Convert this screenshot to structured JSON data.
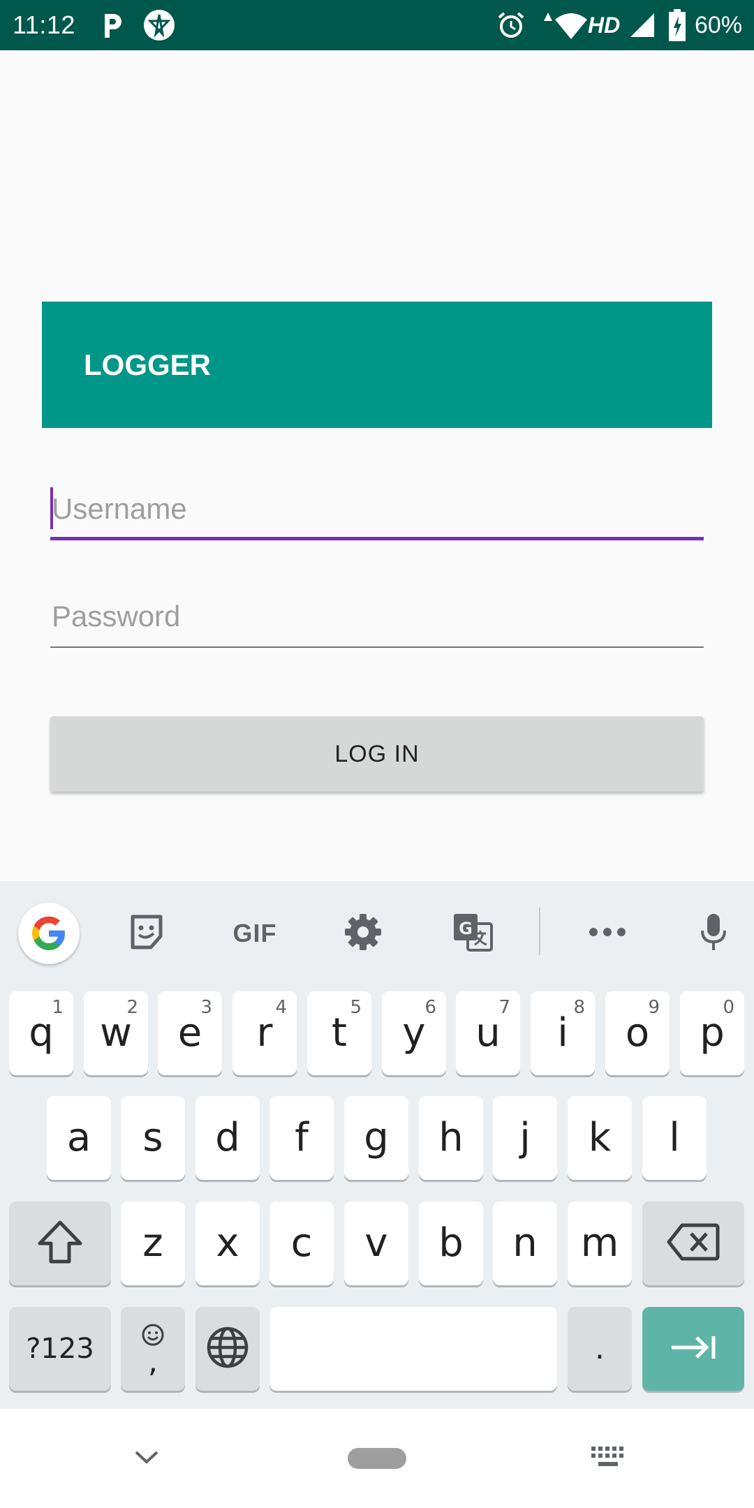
{
  "status_bar": {
    "time": "11:12",
    "network_label": "HD",
    "battery": "60%"
  },
  "banner": {
    "title": "LOGGER"
  },
  "form": {
    "username_placeholder": "Username",
    "password_placeholder": "Password",
    "login_label": "LOG IN"
  },
  "keyboard": {
    "toolbar": {
      "gif_label": "GIF"
    },
    "rows": [
      [
        {
          "label": "q",
          "hint": "1"
        },
        {
          "label": "w",
          "hint": "2"
        },
        {
          "label": "e",
          "hint": "3"
        },
        {
          "label": "r",
          "hint": "4"
        },
        {
          "label": "t",
          "hint": "5"
        },
        {
          "label": "y",
          "hint": "6"
        },
        {
          "label": "u",
          "hint": "7"
        },
        {
          "label": "i",
          "hint": "8"
        },
        {
          "label": "o",
          "hint": "9"
        },
        {
          "label": "p",
          "hint": "0"
        }
      ],
      [
        {
          "label": "a"
        },
        {
          "label": "s"
        },
        {
          "label": "d"
        },
        {
          "label": "f"
        },
        {
          "label": "g"
        },
        {
          "label": "h"
        },
        {
          "label": "j"
        },
        {
          "label": "k"
        },
        {
          "label": "l"
        }
      ],
      [
        {
          "label": "z"
        },
        {
          "label": "x"
        },
        {
          "label": "c"
        },
        {
          "label": "v"
        },
        {
          "label": "b"
        },
        {
          "label": "n"
        },
        {
          "label": "m"
        }
      ]
    ],
    "symbols_label": "?123",
    "comma_label": ",",
    "period_label": "."
  },
  "colors": {
    "status_bar": "#00574b",
    "banner": "#009688",
    "accent": "#7b2fb5",
    "enter_key": "#5fb4a8",
    "keyboard_bg": "#eceff1"
  },
  "icons": {
    "status": [
      "parking-icon",
      "vpn-icon",
      "alarm-icon",
      "wifi-icon",
      "signal-icon",
      "battery-charging-icon"
    ],
    "toolbar": [
      "google-icon",
      "sticker-icon",
      "gif-icon",
      "settings-icon",
      "translate-icon",
      "more-icon",
      "mic-icon"
    ],
    "nav": [
      "chevron-down-icon",
      "home-pill",
      "keyboard-icon"
    ]
  }
}
